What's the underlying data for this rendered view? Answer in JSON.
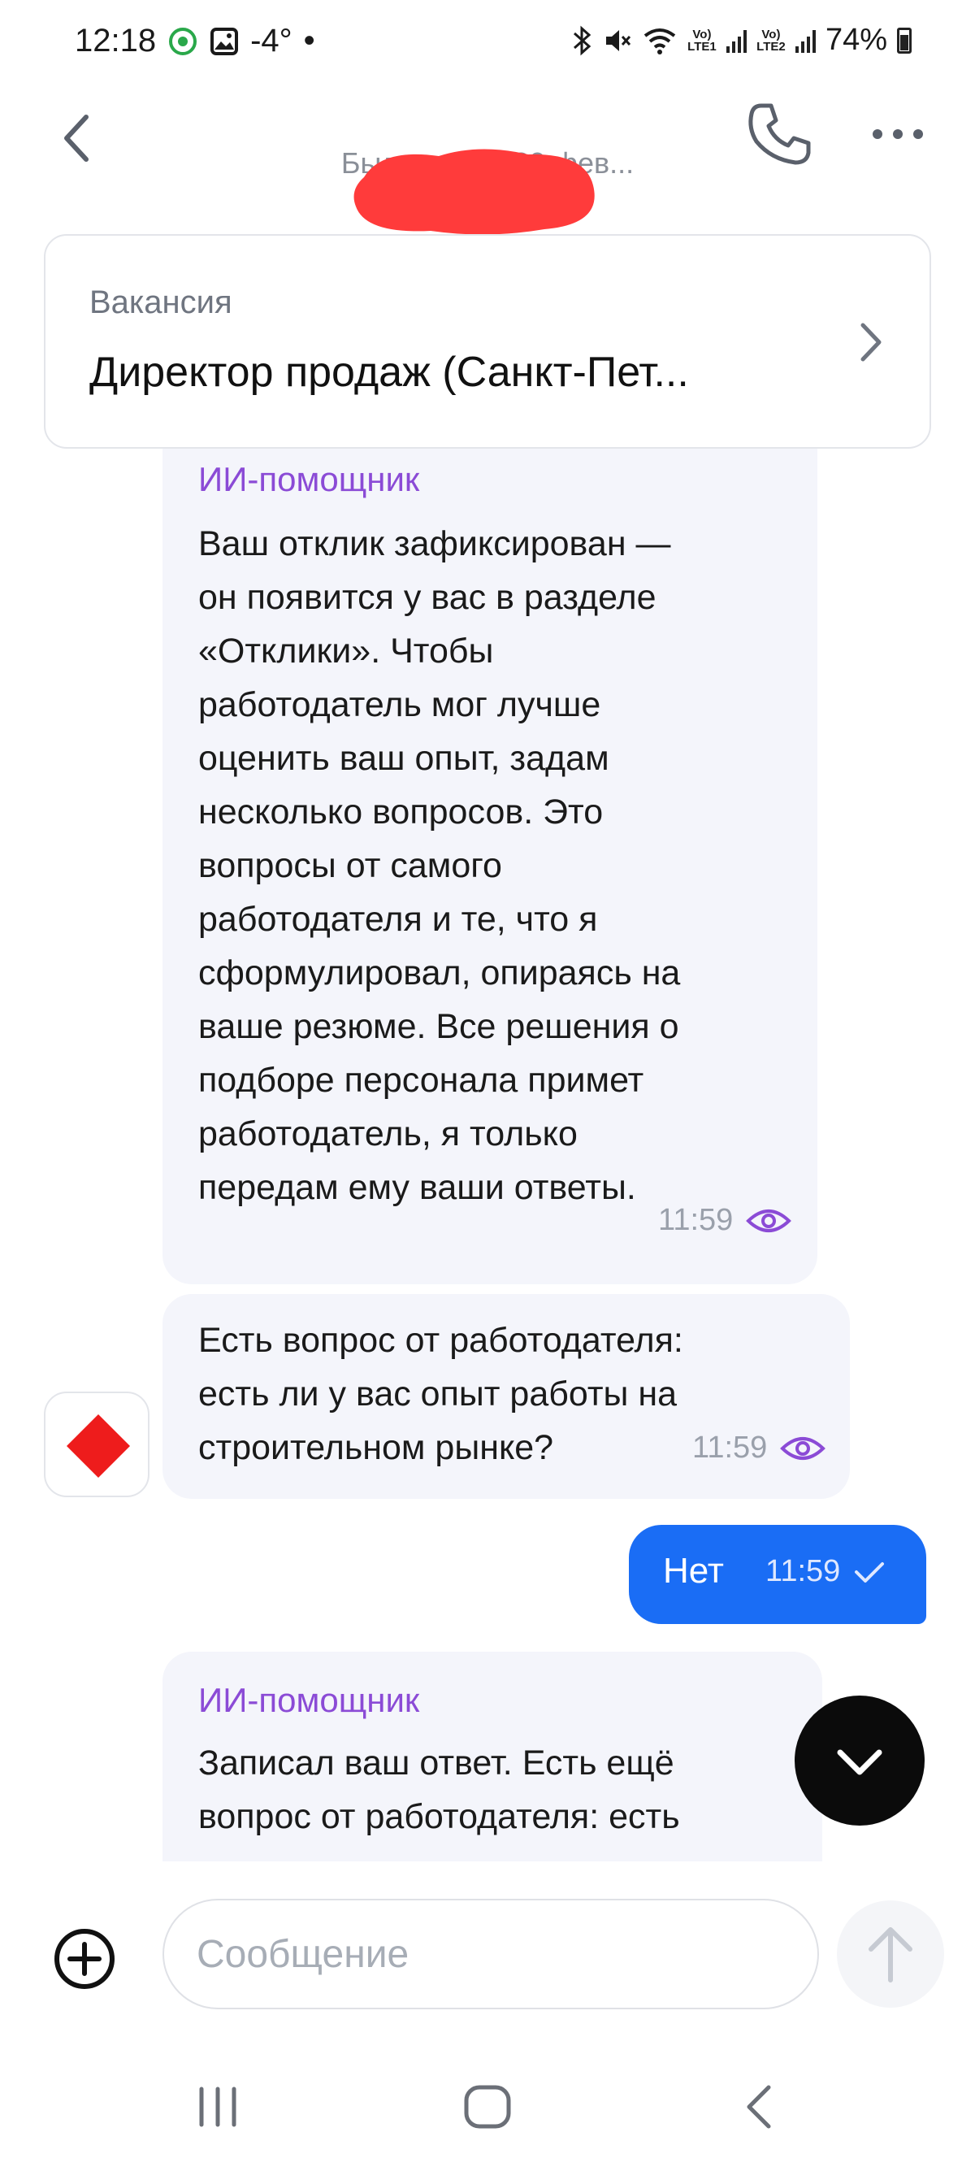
{
  "status_bar": {
    "time": "12:18",
    "temperature": "-4°",
    "dot": "•",
    "net1": "Vo) LTE1",
    "net2": "Vo) LTE2",
    "battery": "74%"
  },
  "header": {
    "contact_name": "",
    "last_seen": "Был онлайн 20 фев..."
  },
  "vacancy": {
    "label": "Вакансия",
    "title": "Директор продаж (Санкт-Пет..."
  },
  "messages": [
    {
      "sender": "ИИ-помощник",
      "text": "Ваш отклик зафиксирован —\nон появится у вас в разделе\n«Отклики». Чтобы\nработодатель мог лучше\nоценить ваш опыт, задам\nнесколько вопросов. Это\nвопросы от самого\nработодателя и те, что я\nсформулировал, опираясь на\nваше резюме. Все решения о\nподборе персонала примет\nработодатель, я только\nпередам ему ваши ответы.",
      "time": "11:59"
    },
    {
      "text": "Есть вопрос от работодателя:\nесть ли у вас опыт работы на\nстроительном рынке?",
      "time": "11:59"
    },
    {
      "text": "Нет",
      "time": "11:59",
      "outgoing": true
    },
    {
      "sender": "ИИ-помощник",
      "text": "Записал ваш ответ. Есть ещё\nвопрос от работодателя: есть\nли у вас опыт управления"
    }
  ],
  "composer": {
    "placeholder": "Сообщение"
  },
  "colors": {
    "accent_purple": "#8b4bd6",
    "outgoing_blue": "#1a6df5",
    "bubble_bg": "#f4f5fb",
    "avatar_red": "#ee1c1c"
  },
  "icons": {
    "back": "chevron-left-icon",
    "phone": "phone-icon",
    "more": "more-dots-icon",
    "chevron": "chevron-right-icon",
    "seen": "eye-icon",
    "check": "check-icon",
    "scroll": "chevron-down-icon",
    "attach": "plus-circle-icon",
    "send": "arrow-up-icon",
    "avatar": "red-diamond-icon"
  }
}
